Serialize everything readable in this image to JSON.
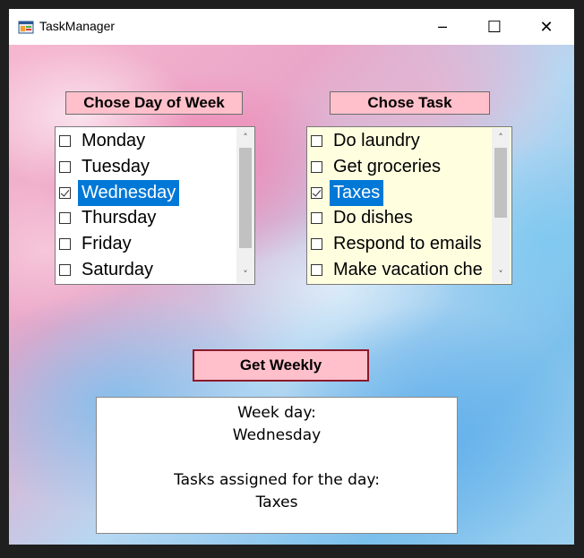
{
  "window": {
    "title": "TaskManager"
  },
  "controls": {
    "minimize": "─",
    "maximize": "☐",
    "close": "✕"
  },
  "days": {
    "header": "Chose Day of Week",
    "items": [
      {
        "label": "Monday",
        "checked": false,
        "selected": false
      },
      {
        "label": "Tuesday",
        "checked": false,
        "selected": false
      },
      {
        "label": "Wednesday",
        "checked": true,
        "selected": true
      },
      {
        "label": "Thursday",
        "checked": false,
        "selected": false
      },
      {
        "label": "Friday",
        "checked": false,
        "selected": false
      },
      {
        "label": "Saturday",
        "checked": false,
        "selected": false
      }
    ]
  },
  "tasks": {
    "header": "Chose Task",
    "items": [
      {
        "label": "Do laundry",
        "checked": false,
        "selected": false
      },
      {
        "label": "Get groceries",
        "checked": false,
        "selected": false
      },
      {
        "label": "Taxes",
        "checked": true,
        "selected": true
      },
      {
        "label": "Do dishes",
        "checked": false,
        "selected": false
      },
      {
        "label": "Respond to emails",
        "checked": false,
        "selected": false
      },
      {
        "label": "Make vacation che",
        "checked": false,
        "selected": false
      }
    ]
  },
  "button": {
    "label": "Get Weekly"
  },
  "output": {
    "week_day_label": "Week day:",
    "week_day_value": "Wednesday",
    "tasks_label": "Tasks assigned for the day:",
    "tasks_value": "Taxes"
  },
  "colors": {
    "label_bg": "#ffc0cb",
    "task_list_bg": "#ffffe0",
    "selection": "#0078d7",
    "button_border": "#8b1a2b"
  },
  "icons": {
    "app": "app-window-icon",
    "scroll_up": "chevron-up-icon",
    "scroll_down": "chevron-down-icon"
  }
}
